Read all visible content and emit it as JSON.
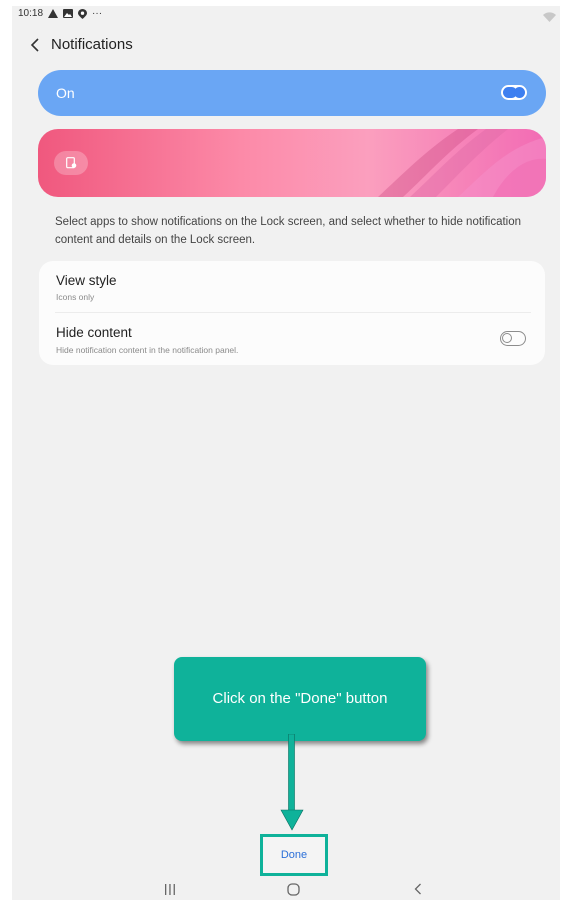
{
  "status_bar": {
    "time": "10:18",
    "icons": [
      "warning-icon",
      "image-icon",
      "location-icon",
      "more-dots-icon"
    ],
    "more": "···"
  },
  "header": {
    "title": "Notifications"
  },
  "main_toggle": {
    "label": "On",
    "state": "on"
  },
  "preview": {
    "icon": "lock-screen-notification-icon"
  },
  "description": "Select apps to show notifications on the Lock screen, and select whether to hide notification content and details on the Lock screen.",
  "settings": [
    {
      "title": "View style",
      "subtitle": "Icons only"
    },
    {
      "title": "Hide content",
      "subtitle": "Hide notification content in the notification panel.",
      "toggle": "off"
    }
  ],
  "callout": {
    "text": "Click on the \"Done\" button"
  },
  "done_button": {
    "label": "Done"
  },
  "colors": {
    "accent_blue": "#6aa6f4",
    "callout_green": "#0fb29a",
    "done_text": "#2b6fd8"
  }
}
